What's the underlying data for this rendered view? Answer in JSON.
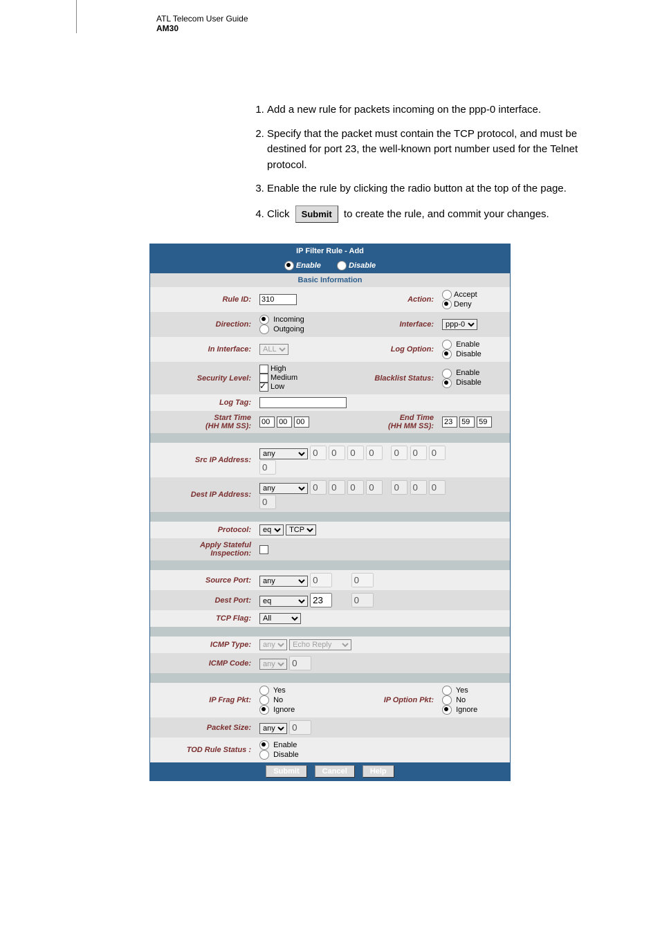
{
  "header": {
    "line1": "ATL Telecom User Guide",
    "line2": "AM30"
  },
  "instructions": [
    "Add a new rule for packets incoming on the ppp-0 interface.",
    "Specify that the packet must contain the TCP protocol, and must be destined for port 23, the well-known port number used for the Telnet protocol.",
    "Enable the rule by clicking the radio button at the top of the page.",
    {
      "prefix": "Click ",
      "button": "Submit",
      "suffix": " to create the rule, and commit your changes."
    }
  ],
  "panel": {
    "title": "IP Filter Rule - Add",
    "enable": "Enable",
    "disable": "Disable",
    "basic_info": "Basic Information",
    "labels": {
      "rule_id": "Rule ID:",
      "action": "Action:",
      "direction": "Direction:",
      "interface": "Interface:",
      "in_interface": "In Interface:",
      "log_option": "Log Option:",
      "security_level": "Security Level:",
      "blacklist_status": "Blacklist Status:",
      "log_tag": "Log Tag:",
      "start_time": "Start Time",
      "start_time2": "(HH MM SS):",
      "end_time": "End Time",
      "end_time2": "(HH MM SS):",
      "src_ip": "Src IP Address:",
      "dest_ip": "Dest IP Address:",
      "protocol": "Protocol:",
      "stateful": "Apply Stateful",
      "stateful2": "Inspection:",
      "source_port": "Source Port:",
      "dest_port": "Dest Port:",
      "tcp_flag": "TCP Flag:",
      "icmp_type": "ICMP Type:",
      "icmp_code": "ICMP Code:",
      "ip_frag": "IP Frag Pkt:",
      "ip_option": "IP Option Pkt:",
      "packet_size": "Packet Size:",
      "tod_rule": "TOD Rule Status :"
    },
    "values": {
      "rule_id": "310",
      "action_accept": "Accept",
      "action_deny": "Deny",
      "dir_incoming": "Incoming",
      "dir_outgoing": "Outgoing",
      "interface": "ppp-0",
      "in_interface": "ALL",
      "enable": "Enable",
      "disable": "Disable",
      "sec_high": "High",
      "sec_medium": "Medium",
      "sec_low": "Low",
      "start_h": "00",
      "start_m": "00",
      "start_s": "00",
      "end_h": "23",
      "end_m": "59",
      "end_s": "59",
      "ip_any": "any",
      "zero": "0",
      "proto_op": "eq",
      "proto": "TCP",
      "port_any": "any",
      "port_eq": "eq",
      "dest_port": "23",
      "tcp_flag": "All",
      "icmp_type_op": "any",
      "icmp_type": "Echo Reply",
      "icmp_code_op": "any",
      "icmp_code": "0",
      "yes": "Yes",
      "no": "No",
      "ignore": "Ignore",
      "packet_size_op": "any",
      "packet_size": "0",
      "tod_enable": "Enable",
      "tod_disable": "Disable"
    },
    "buttons": {
      "submit": "Submit",
      "cancel": "Cancel",
      "help": "Help"
    }
  }
}
